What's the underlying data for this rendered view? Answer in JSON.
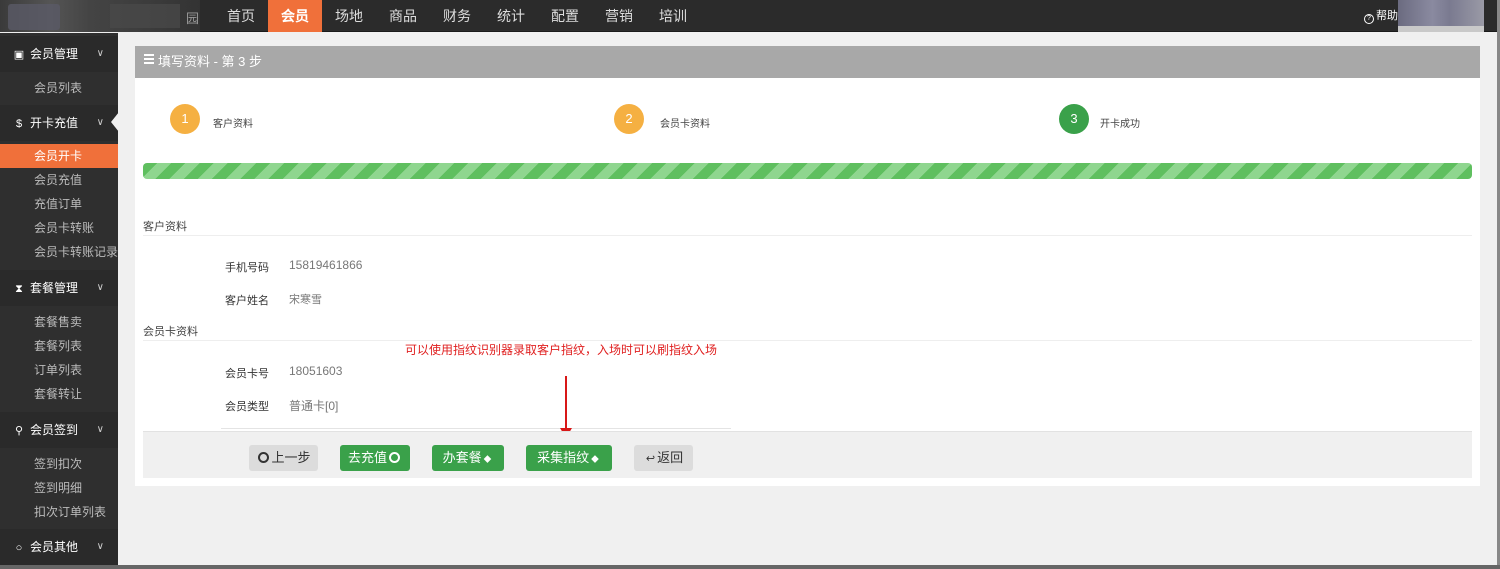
{
  "nav": {
    "logo_glyph": "园",
    "items": [
      "首页",
      "会员",
      "场地",
      "商品",
      "财务",
      "统计",
      "配置",
      "营销",
      "培训"
    ],
    "active_index": 1,
    "help": "帮助"
  },
  "sidebar": {
    "groups": [
      {
        "label": "会员管理",
        "icon": "id-card-icon",
        "items": [
          "会员列表"
        ]
      },
      {
        "label": "开卡充值",
        "icon": "dollar-icon",
        "items": [
          "会员开卡",
          "会员充值",
          "充值订单",
          "会员卡转账",
          "会员卡转账记录"
        ]
      },
      {
        "label": "套餐管理",
        "icon": "hourglass-icon",
        "items": [
          "套餐售卖",
          "套餐列表",
          "订单列表",
          "套餐转让"
        ]
      },
      {
        "label": "会员签到",
        "icon": "map-pin-icon",
        "items": [
          "签到扣次",
          "签到明细",
          "扣次订单列表"
        ]
      },
      {
        "label": "会员其他",
        "icon": "circle-icon",
        "items": []
      }
    ],
    "active_item": "会员开卡"
  },
  "panel": {
    "title": "填写资料 - 第 3 步",
    "steps": [
      {
        "num": "1",
        "label": "客户资料"
      },
      {
        "num": "2",
        "label": "会员卡资料"
      },
      {
        "num": "3",
        "label": "开卡成功"
      }
    ],
    "progress_fraction": 1.0,
    "customer_section": "客户资料",
    "customer_fields": [
      {
        "label": "手机号码",
        "value": "15819461866"
      },
      {
        "label": "客户姓名",
        "value": "宋寒雪"
      }
    ],
    "card_section": "会员卡资料",
    "card_fields": [
      {
        "label": "会员卡号",
        "value": "18051603"
      },
      {
        "label": "会员类型",
        "value": "普通卡[0]"
      }
    ],
    "annotation": "可以使用指纹识别器录取客户指纹，入场时可以刷指纹入场",
    "buttons": {
      "prev": "上一步",
      "recharge": "去充值",
      "package": "办套餐",
      "fingerprint": "采集指纹",
      "back": "返回"
    }
  },
  "colors": {
    "accent": "#f0703a",
    "step_pending": "#f5b042",
    "step_done": "#3aa14a",
    "annotation": "#e02020"
  }
}
